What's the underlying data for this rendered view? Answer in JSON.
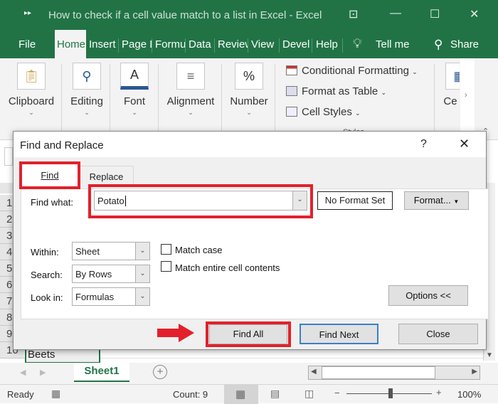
{
  "window": {
    "title": "How to check if a cell value match to a list in Excel  -  Excel"
  },
  "ribbon_tabs": [
    "File",
    "Home",
    "Insert",
    "Page L",
    "Formu",
    "Data",
    "Review",
    "View",
    "Devel",
    "Help"
  ],
  "tell_me": "Tell me",
  "share": "Share",
  "groups": {
    "clipboard": "Clipboard",
    "editing": "Editing",
    "font": "Font",
    "alignment": "Alignment",
    "number": "Number",
    "cells": "Ce",
    "conditional": "Conditional Formatting",
    "format_table": "Format as Table",
    "cell_styles": "Cell Styles",
    "styles": "Styles"
  },
  "rows": [
    "1",
    "2",
    "3",
    "4",
    "5",
    "6",
    "7",
    "8",
    "9",
    "10"
  ],
  "cell_a10": "Beets",
  "dialog": {
    "title": "Find and Replace",
    "help": "?",
    "tab_find": "Find",
    "tab_replace": "Replace",
    "find_what_label": "Find what:",
    "find_what_value": "Potato",
    "no_format": "No Format Set",
    "format_btn": "Format...",
    "within_label": "Within:",
    "within_value": "Sheet",
    "search_label": "Search:",
    "search_value": "By Rows",
    "lookin_label": "Look in:",
    "lookin_value": "Formulas",
    "match_case": "Match case",
    "match_entire": "Match entire cell contents",
    "options": "Options <<",
    "find_all": "Find All",
    "find_next": "Find Next",
    "close": "Close"
  },
  "sheet_tab": "Sheet1",
  "status": {
    "ready": "Ready",
    "count": "Count: 9",
    "zoom": "100%"
  },
  "colors": {
    "excel_green": "#217346",
    "highlight_red": "#e3202b"
  }
}
